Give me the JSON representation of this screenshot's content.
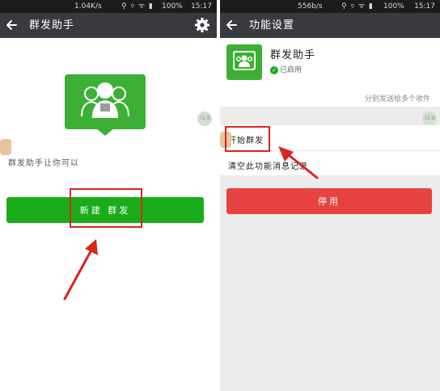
{
  "left": {
    "status": {
      "speed": "1.04K/s",
      "icons": "⚲ ▿ ᯤ ▮",
      "battery": "100%",
      "time": "15:17"
    },
    "header": {
      "title": "群发助手",
      "back_icon": "back-arrow-icon",
      "settings_icon": "gear-icon"
    },
    "description": "群发助手让你可以",
    "new_broadcast_label": "新建 群发",
    "side_badge": "72.8",
    "logo_icon": "group-contacts-icon"
  },
  "right": {
    "status": {
      "speed": "556b/s",
      "icons": "⚲ ▿ ᯤ ▮",
      "battery": "100%",
      "time": "15:17"
    },
    "header": {
      "title": "功能设置",
      "back_icon": "back-arrow-icon"
    },
    "plugin": {
      "name": "群发助手",
      "status": "已启用"
    },
    "note": "分别发送给多个收件",
    "menu": {
      "start": "开始群发",
      "clear": "清空此功能消息记录"
    },
    "stop_label": "停用",
    "side_badge": "72.8"
  },
  "colors": {
    "green": "#1aad19",
    "red": "#e64340",
    "header": "#393a3f",
    "highlight": "#d7261b"
  }
}
